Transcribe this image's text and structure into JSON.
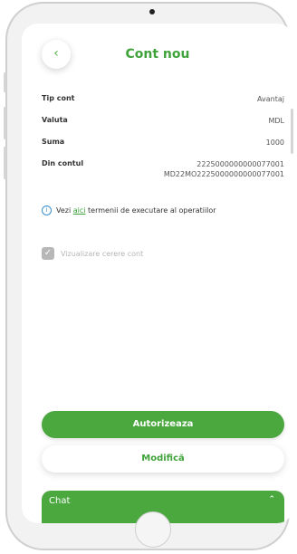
{
  "header": {
    "title": "Cont nou",
    "back_icon": "chevron-left-icon"
  },
  "details": {
    "rows": [
      {
        "label": "Tip cont",
        "value": "Avantaj"
      },
      {
        "label": "Valuta",
        "value": "MDL"
      },
      {
        "label": "Suma",
        "value": "1000"
      }
    ],
    "source": {
      "label": "Din contul",
      "value_line1": "2225000000000077001",
      "value_line2": "MD22MO2225000000000077001"
    }
  },
  "info": {
    "prefix": "Vezi",
    "link": "aici",
    "suffix": "termenii de executare al operatiilor"
  },
  "checkbox": {
    "label": "Vizualizare cerere cont",
    "checked": true
  },
  "actions": {
    "primary": "Autorizeaza",
    "secondary": "Modifică"
  },
  "chat": {
    "label": "Chat"
  },
  "colors": {
    "accent": "#4aa83f",
    "title": "#3fa33a",
    "info": "#3a8fd0"
  }
}
